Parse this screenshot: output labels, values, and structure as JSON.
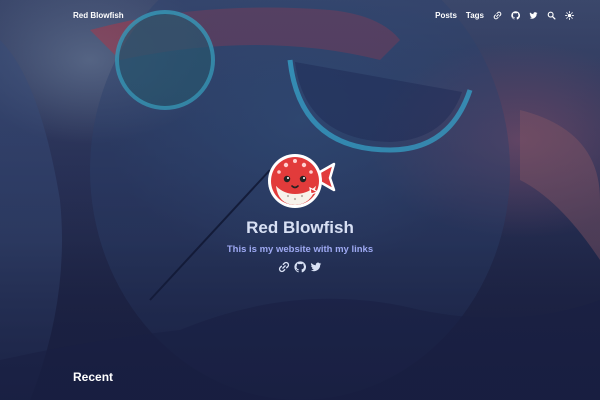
{
  "header": {
    "site_title": "Red Blowfish",
    "nav": [
      {
        "label": "Posts"
      },
      {
        "label": "Tags"
      }
    ],
    "icons": [
      "link-icon",
      "github-icon",
      "twitter-icon",
      "search-icon",
      "theme-toggle-icon"
    ]
  },
  "hero": {
    "logo": "blowfish-logo",
    "name": "Red Blowfish",
    "tagline": "This is my website with my links",
    "social_icons": [
      "link-icon",
      "github-icon",
      "twitter-icon"
    ]
  },
  "sections": {
    "recent_title": "Recent"
  },
  "colors": {
    "name": "#d8e0f4",
    "tagline": "#9ea9f2",
    "background": "#1c2440",
    "logo_red": "#e23b3b"
  }
}
